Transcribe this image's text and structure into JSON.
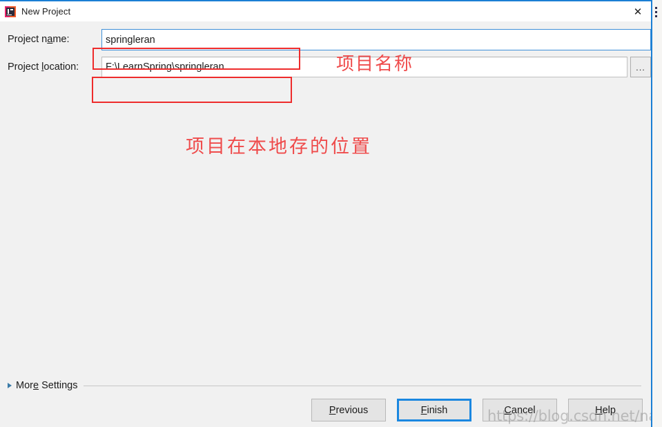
{
  "window": {
    "title": "New Project",
    "app_icon": "intellij-idea-icon",
    "close_label": "✕",
    "accent_color": "#1b7fd4"
  },
  "desktop": {
    "menu_icon": "vertical-dots-icon"
  },
  "form": {
    "name_field": {
      "label_prefix": "Project n",
      "label_mnemonic": "a",
      "label_suffix": "me:",
      "value": "springleran",
      "placeholder": ""
    },
    "location_field": {
      "label_prefix": "Project ",
      "label_mnemonic": "l",
      "label_suffix": "ocation:",
      "value": "F:\\LearnSpring\\springleran",
      "placeholder": "",
      "browse_label": "..."
    }
  },
  "annotations": {
    "color": "#ee2b2b",
    "name_note": "项目名称",
    "location_note": "项目在本地存的位置"
  },
  "more_settings": {
    "label_prefix": "Mor",
    "label_mnemonic": "e",
    "label_suffix": " Settings",
    "expanded": false
  },
  "buttons": [
    {
      "name": "previous",
      "prefix": "",
      "mnemonic": "P",
      "suffix": "revious",
      "primary": false
    },
    {
      "name": "finish",
      "prefix": "",
      "mnemonic": "F",
      "suffix": "inish",
      "primary": true
    },
    {
      "name": "cancel",
      "prefix": "",
      "mnemonic": "C",
      "suffix": "ancel",
      "primary": false
    },
    {
      "name": "help",
      "prefix": "",
      "mnemonic": "H",
      "suffix": "elp",
      "primary": false
    }
  ],
  "watermark": {
    "text": "https://blog.csdn.net/naoYanCC"
  }
}
